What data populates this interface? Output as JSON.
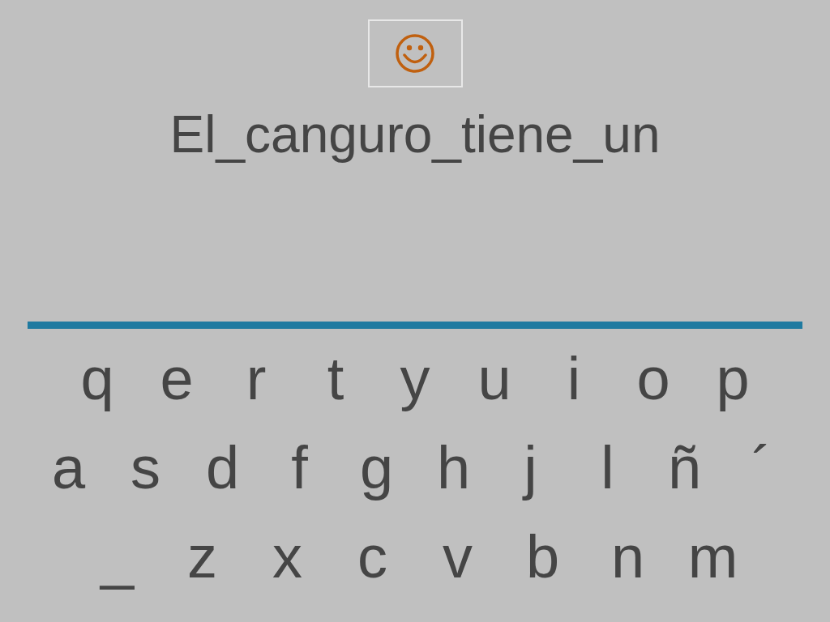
{
  "sentence": "El_canguro_tiene_un",
  "keyboard": [
    [
      "q",
      "e",
      "r",
      "t",
      "y",
      "u",
      "i",
      "o",
      "p"
    ],
    [
      "a",
      "s",
      "d",
      "f",
      "g",
      "h",
      "j",
      "l",
      "ñ",
      "´"
    ],
    [
      "_",
      "z",
      "x",
      "c",
      "v",
      "b",
      "n",
      "m"
    ]
  ]
}
